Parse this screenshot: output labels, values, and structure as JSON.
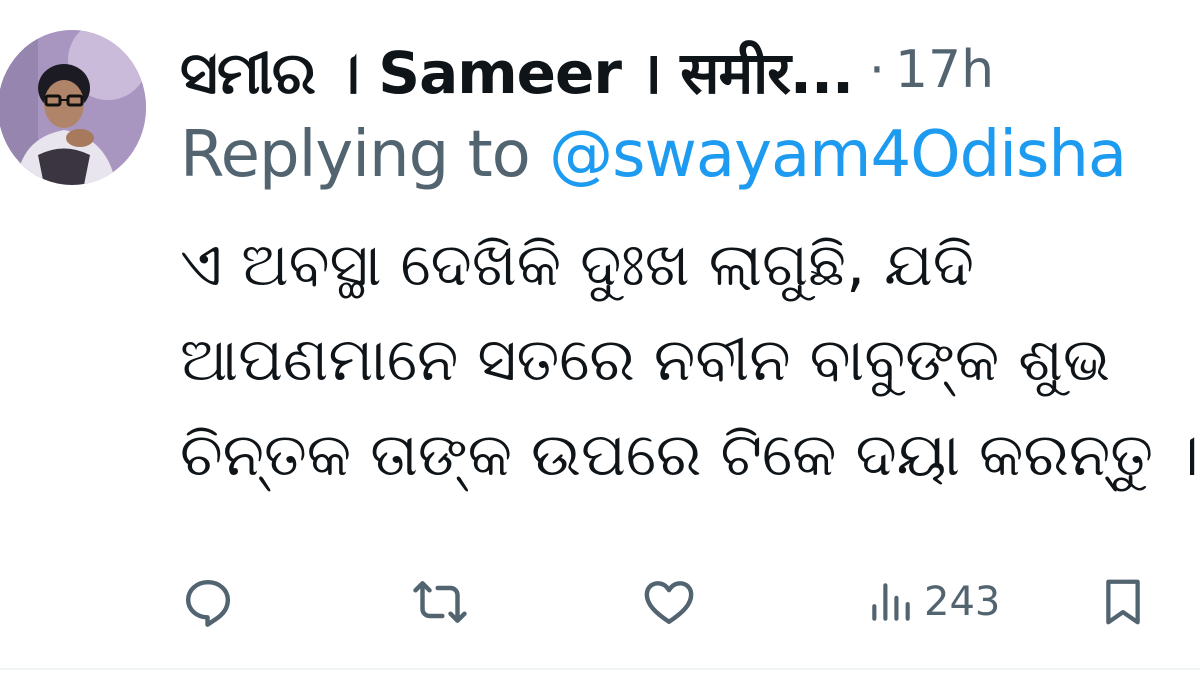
{
  "tweet": {
    "author": {
      "display_name": "ସମୀର । Sameer । समीर...",
      "avatar_icon": "user-avatar"
    },
    "separator": "·",
    "time": "17h",
    "reply_prefix": "Replying to ",
    "reply_handle": "@swayam4Odisha",
    "body_lines": [
      "ଏ ଅବସ୍ଥା ଦେଖିକି ଦୁଃଖ ଲାଗୁଛି, ଯଦି",
      "ଆପଣମାନେ ସତରେ ନବୀନ ବାବୁଙ୍କ ଶୁଭ",
      "ଚିନ୍ତକ ତାଙ୍କ ଉପରେ ଟିକେ ଦୟା କରନ୍ତୁ ।"
    ],
    "actions": {
      "reply_icon": "reply-icon",
      "retweet_icon": "retweet-icon",
      "like_icon": "heart-icon",
      "views_icon": "views-icon",
      "views_count": "243",
      "bookmark_icon": "bookmark-icon"
    },
    "colors": {
      "text": "#0f1419",
      "secondary": "#536471",
      "link": "#1d9bf0"
    }
  }
}
